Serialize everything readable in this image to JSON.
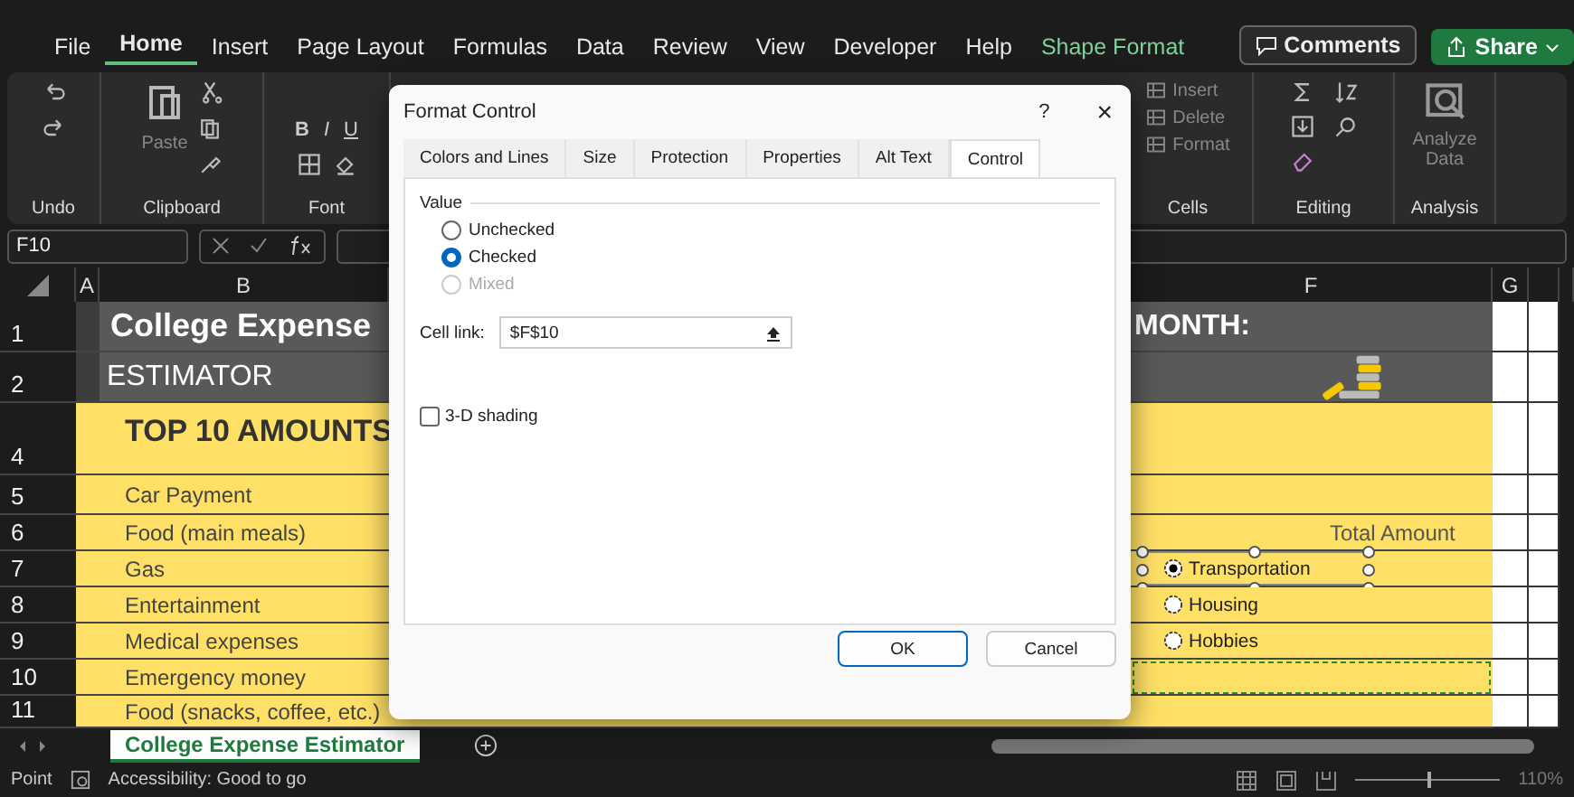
{
  "menu_tabs": [
    {
      "label": "File",
      "selected": false,
      "contextual": false
    },
    {
      "label": "Home",
      "selected": true,
      "contextual": false
    },
    {
      "label": "Insert",
      "selected": false,
      "contextual": false
    },
    {
      "label": "Page Layout",
      "selected": false,
      "contextual": false
    },
    {
      "label": "Formulas",
      "selected": false,
      "contextual": false
    },
    {
      "label": "Data",
      "selected": false,
      "contextual": false
    },
    {
      "label": "Review",
      "selected": false,
      "contextual": false
    },
    {
      "label": "View",
      "selected": false,
      "contextual": false
    },
    {
      "label": "Developer",
      "selected": false,
      "contextual": false
    },
    {
      "label": "Help",
      "selected": false,
      "contextual": false
    },
    {
      "label": "Shape Format",
      "selected": false,
      "contextual": true
    }
  ],
  "header_buttons": [
    {
      "label": "Comments",
      "kind": "outline"
    },
    {
      "label": "Share",
      "kind": "primary"
    }
  ],
  "ribbon_groups": [
    {
      "kind": "undo",
      "label": "Undo"
    },
    {
      "kind": "clipboard",
      "label": "Clipboard",
      "items": [
        "Paste"
      ]
    },
    {
      "kind": "font",
      "label": "Font",
      "items": [
        "B",
        "I",
        "U"
      ]
    },
    {
      "kind": "cells",
      "label": "Cells",
      "items": [
        "Insert",
        "Delete",
        "Format"
      ]
    },
    {
      "kind": "editing",
      "label": "Editing"
    },
    {
      "kind": "analysis",
      "label": "Analysis",
      "items": [
        "Analyze Data"
      ]
    }
  ],
  "name_box": "F10",
  "columns": [
    "A",
    "B",
    "F",
    "G"
  ],
  "rows": [
    {
      "number": "1",
      "kind": "title",
      "b": "College Expense",
      "f": {
        "kind": "text",
        "label": "MONTH:"
      },
      "f_selected": false
    },
    {
      "number": "2",
      "kind": "subtitle",
      "b": "ESTIMATOR",
      "f": {
        "kind": "coins"
      },
      "f_selected": false
    },
    {
      "number": "4",
      "kind": "heading",
      "b": "TOP 10 AMOUNTS",
      "f_selected": false
    },
    {
      "number": "5",
      "kind": "item",
      "b": "Car Payment",
      "f_selected": false
    },
    {
      "number": "6",
      "kind": "item",
      "b": "Food (main meals)",
      "f": {
        "kind": "caption",
        "label": "Total Amount"
      },
      "f_selected": false
    },
    {
      "number": "7",
      "kind": "item",
      "b": "Gas",
      "f": {
        "kind": "option",
        "label": "Transportation",
        "selected": true,
        "handles": true
      },
      "f_selected": false
    },
    {
      "number": "8",
      "kind": "item",
      "b": "Entertainment",
      "f": {
        "kind": "option",
        "label": "Housing",
        "selected": false,
        "handles": false
      },
      "f_selected": false
    },
    {
      "number": "9",
      "kind": "item",
      "b": "Medical expenses",
      "f": {
        "kind": "option",
        "label": "Hobbies",
        "selected": false,
        "handles": false
      },
      "f_selected": false
    },
    {
      "number": "10",
      "kind": "item",
      "b": "Emergency money",
      "f_selected": true
    },
    {
      "number": "11",
      "kind": "item",
      "b": "Food (snacks, coffee, etc.)",
      "f_selected": false
    }
  ],
  "sheet_tabs": [
    {
      "label": "College Expense Estimator",
      "selected": true
    }
  ],
  "status": {
    "mode": "Point",
    "accessibility": "Accessibility: Good to go",
    "zoom": "110%",
    "zoom_slider": {
      "level": 0.5
    }
  },
  "dialog": {
    "title": "Format Control",
    "help": "?",
    "close": "×",
    "tabs": [
      {
        "label": "Colors and Lines",
        "selected": false
      },
      {
        "label": "Size",
        "selected": false
      },
      {
        "label": "Protection",
        "selected": false
      },
      {
        "label": "Properties",
        "selected": false
      },
      {
        "label": "Alt Text",
        "selected": false
      },
      {
        "label": "Control",
        "selected": true
      }
    ],
    "value_legend": "Value",
    "options": [
      {
        "label": "Unchecked",
        "selected": false,
        "disabled": false
      },
      {
        "label": "Checked",
        "selected": true,
        "disabled": false
      },
      {
        "label": "Mixed",
        "selected": false,
        "disabled": true
      }
    ],
    "cell_link_label": "Cell link:",
    "cell_link_value": "$F$10",
    "shading": {
      "label": "3-D shading",
      "checked": false
    },
    "buttons": [
      {
        "label": "OK",
        "kind": "default"
      },
      {
        "label": "Cancel",
        "kind": "normal"
      }
    ]
  }
}
